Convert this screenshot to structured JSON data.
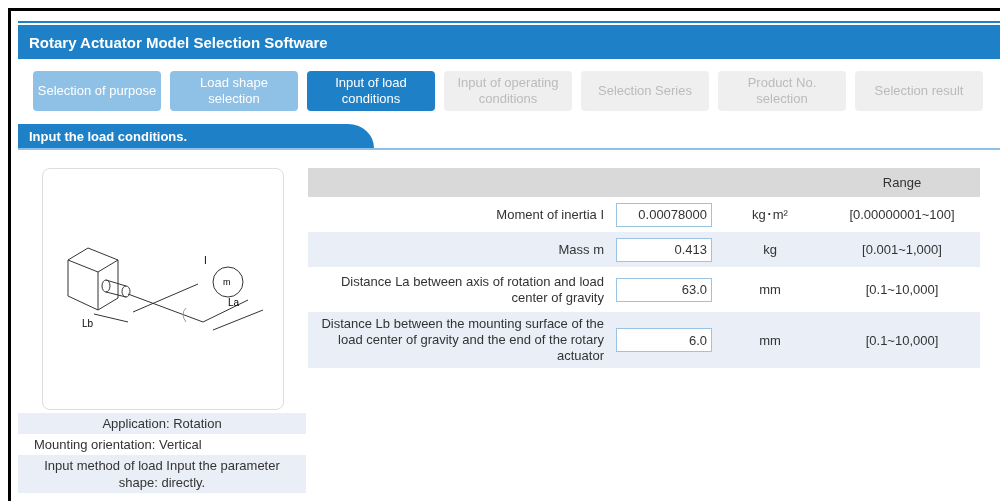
{
  "window": {
    "title": "Rotary Actuator Model Selection Software"
  },
  "steps": [
    {
      "label": "Selection of purpose",
      "selected": false,
      "disabled": false
    },
    {
      "label": "Load shape selection",
      "selected": false,
      "disabled": false
    },
    {
      "label": "Input of load conditions",
      "selected": true,
      "disabled": false
    },
    {
      "label": "Input of operating conditions",
      "selected": false,
      "disabled": true
    },
    {
      "label": "Selection Series",
      "selected": false,
      "disabled": true
    },
    {
      "label": "Product No. selection",
      "selected": false,
      "disabled": true
    },
    {
      "label": "Selection result",
      "selected": false,
      "disabled": true
    }
  ],
  "section_tab": "Input the load conditions.",
  "diagram": {
    "labels": [
      "I",
      "m",
      "La",
      "Lb"
    ]
  },
  "summary": [
    "Application: Rotation",
    "Mounting orientation: Vertical",
    "Input method of load Input the parameter shape: directly."
  ],
  "table": {
    "columns": [
      "Range"
    ],
    "rows": [
      {
        "label": "Moment of inertia I",
        "value": "0.00078000",
        "unit": "kg･m²",
        "range": "[0.00000001~100]"
      },
      {
        "label": "Mass m",
        "value": "0.413",
        "unit": "kg",
        "range": "[0.001~1,000]"
      },
      {
        "label": "Distance La between axis of rotation and load center of gravity",
        "value": "63.0",
        "unit": "mm",
        "range": "[0.1~10,000]"
      },
      {
        "label": "Distance Lb between the mounting surface of the load center of gravity and the end of the rotary actuator",
        "value": "6.0",
        "unit": "mm",
        "range": "[0.1~10,000]"
      }
    ]
  }
}
